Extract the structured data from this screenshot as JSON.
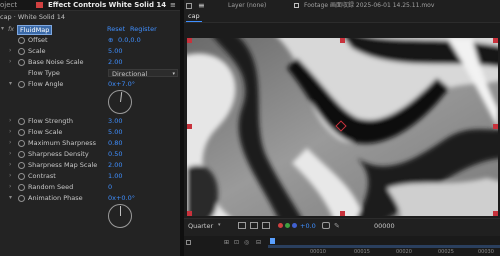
{
  "left_panel": {
    "tab_project": "oject",
    "tab_title": "Effect Controls White Solid 14",
    "breadcrumb": "cap · White Solid 14",
    "effect": {
      "fx": "fx",
      "name": "FluidMap",
      "reset": "Reset",
      "register": "Register"
    },
    "props": [
      {
        "label": "Offset",
        "value": "0.0,0.0"
      },
      {
        "label": "Scale",
        "value": "5.00"
      },
      {
        "label": "Base Noise Scale",
        "value": "2.00"
      },
      {
        "label": "Flow Type",
        "value": "Directional"
      },
      {
        "label": "Flow Angle",
        "value": "0x+7.0°"
      },
      {
        "label": "Flow Strength",
        "value": "3.00"
      },
      {
        "label": "Flow Scale",
        "value": "5.00"
      },
      {
        "label": "Maximum Sharpness",
        "value": "0.80"
      },
      {
        "label": "Sharpness Density",
        "value": "0.50"
      },
      {
        "label": "Sharpness Map Scale",
        "value": "2.00"
      },
      {
        "label": "Contrast",
        "value": "1.00"
      },
      {
        "label": "Random Seed",
        "value": "0"
      },
      {
        "label": "Animation Phase",
        "value": "0x+0.0°"
      }
    ]
  },
  "right_panel": {
    "tab_comp": "cap",
    "tab_layer": "Layer (none)",
    "tab_footage": "Footage 画面収録 2025-06-01 14.25.11.mov",
    "zoom": "Quarter",
    "exposure": "+0.0",
    "timecode": "00000",
    "ruler": [
      "00010",
      "00015",
      "00020",
      "00025",
      "00030"
    ]
  },
  "colors": {
    "accent_blue": "#3f8fff",
    "handle_red": "#c8323c",
    "timecode_blue": "#5aa0ff"
  }
}
